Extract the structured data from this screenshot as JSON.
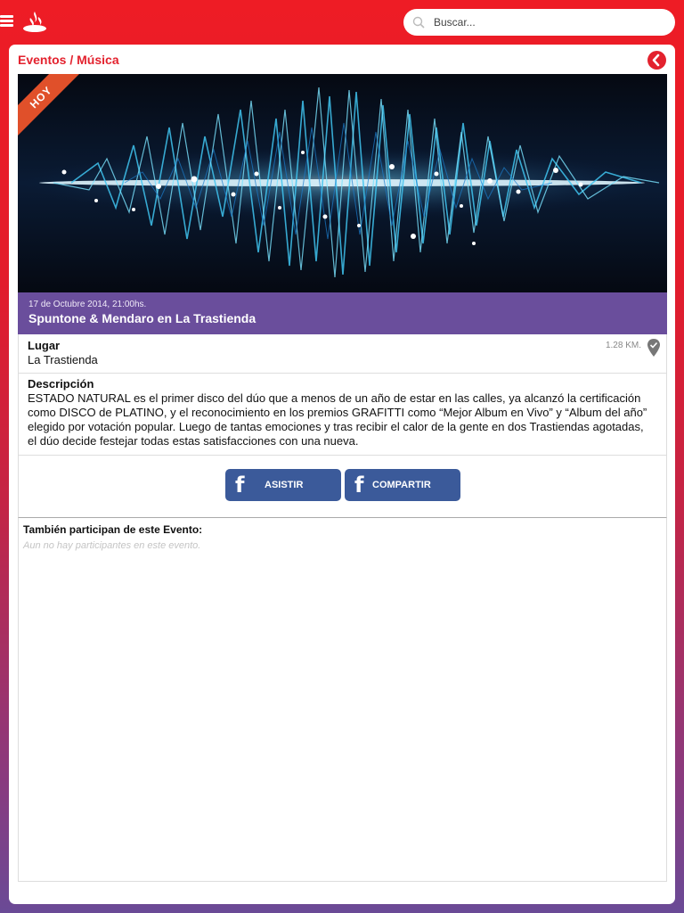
{
  "topbar": {
    "search_placeholder": "Buscar..."
  },
  "breadcrumb": {
    "section": "Eventos",
    "separator": " / ",
    "category": "Música"
  },
  "event": {
    "badge": "HOY",
    "date": "17 de Octubre 2014, 21:00hs.",
    "title": "Spuntone & Mendaro en La Trastienda",
    "place_label": "Lugar",
    "place_value": "La Trastienda",
    "distance": "1.28 KM.",
    "description_label": "Descripción",
    "description": "ESTADO NATURAL es el primer disco del dúo que a menos de un año de estar en las calles, ya alcanzó la certificación como DISCO de PLATINO, y el reconocimiento en los premios GRAFITTI como “Mejor Album en Vivo” y “Album del año” elegido por votación popular. Luego de tantas emociones y tras recibir el calor de la gente en dos Trastiendas agotadas, el dúo decide festejar todas estas satisfacciones con una nueva."
  },
  "actions": {
    "attend_label": "ASISTIR",
    "share_label": "COMPARTIR",
    "fb_glyph": "f"
  },
  "participants": {
    "title": "También participan de este Evento:",
    "empty": "Aun no hay participantes en este evento."
  },
  "colors": {
    "brand_red": "#e3222e",
    "event_purple": "#6a4e9c",
    "facebook_blue": "#3b5a9a",
    "badge_orange": "#e0502a"
  },
  "icons": [
    "menu-icon",
    "santander-logo-icon",
    "search-icon",
    "back-arrow-icon",
    "location-pin-icon",
    "facebook-icon"
  ]
}
